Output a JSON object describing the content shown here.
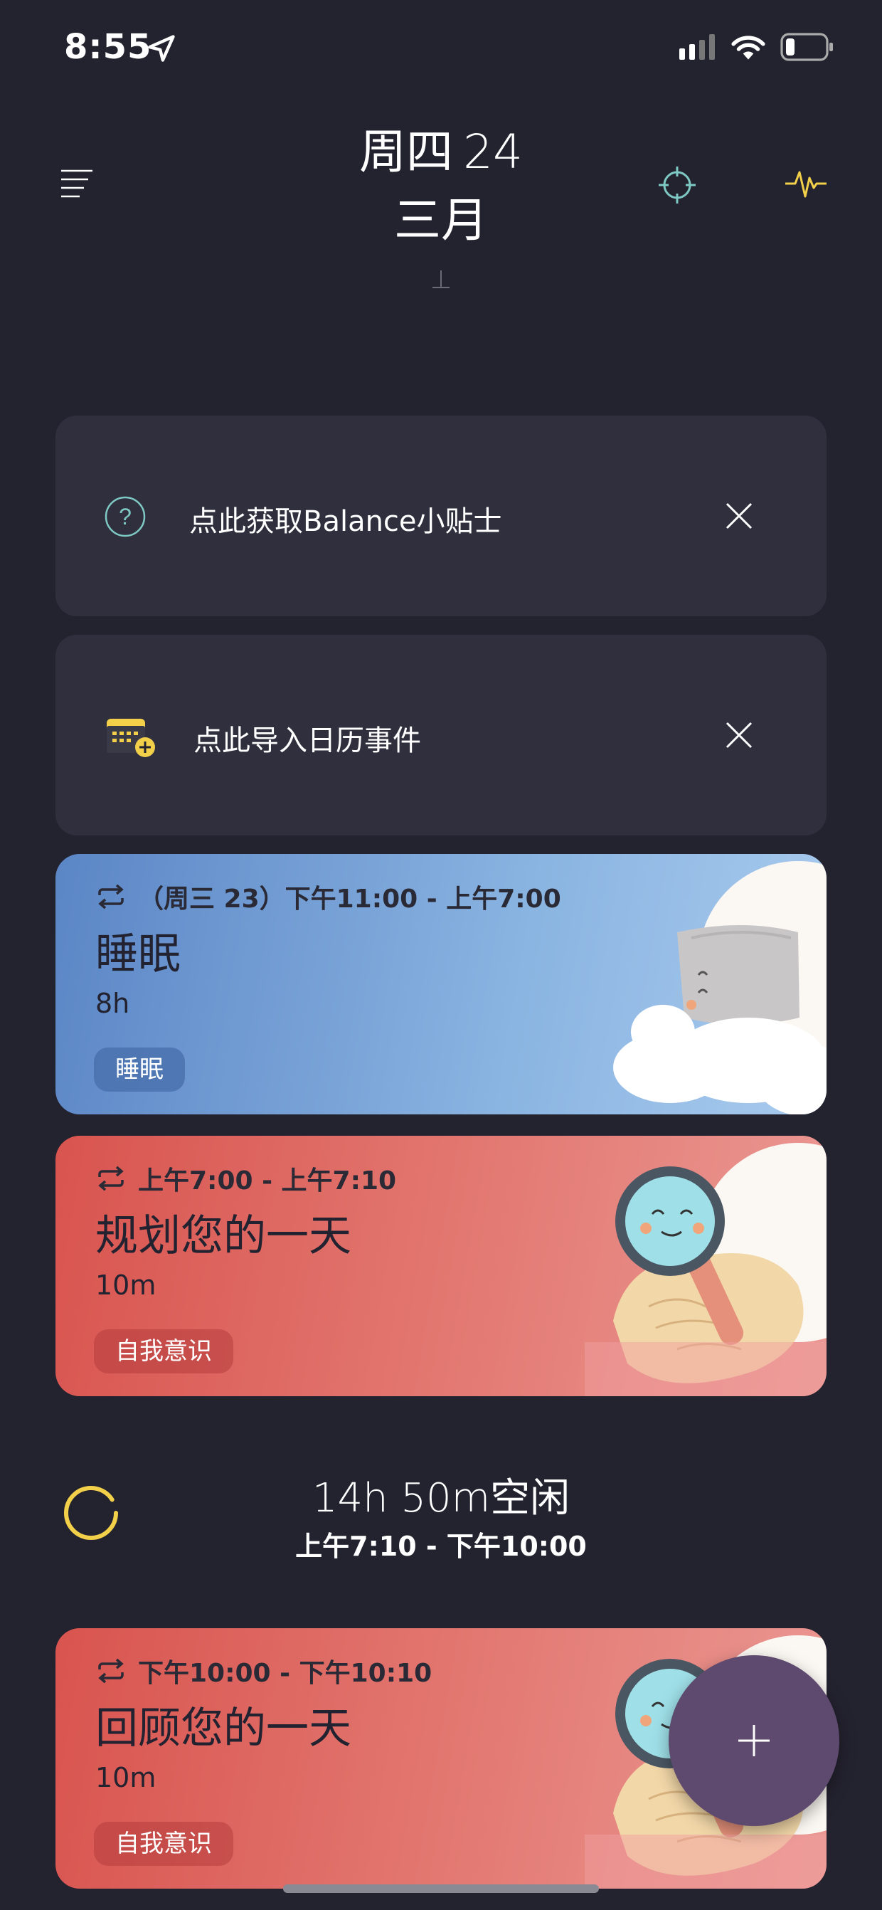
{
  "status": {
    "time": "8:55"
  },
  "header": {
    "weekday": "周四",
    "day": "24",
    "month": "三月"
  },
  "notices": [
    {
      "text": "点此获取Balance小贴士",
      "icon": "help-circle-icon"
    },
    {
      "text": "点此导入日历事件",
      "icon": "calendar-add-icon"
    }
  ],
  "cards": [
    {
      "time_range": "（周三 23）下午11:00 - 上午7:00",
      "title": "睡眠",
      "duration": "8h",
      "tag": "睡眠",
      "art": "sleeping-pillow-illustration"
    },
    {
      "time_range": "上午7:00 - 上午7:10",
      "title": "规划您的一天",
      "duration": "10m",
      "tag": "自我意识",
      "art": "magnifier-map-illustration"
    },
    {
      "time_range": "下午10:00 - 下午10:10",
      "title": "回顾您的一天",
      "duration": "10m",
      "tag": "自我意识",
      "art": "magnifier-map-illustration"
    }
  ],
  "free_slot": {
    "title": "14h 50m空闲",
    "range": "上午7:10 - 下午10:00"
  },
  "colors": {
    "background": "#23222f",
    "card_dark": "#302f3d",
    "accent_yellow": "#f2d04a",
    "accent_teal": "#7ec9c3",
    "fab": "#5e4a6e",
    "sleep_blue": "#6c98d2",
    "self_red": "#de6560"
  }
}
